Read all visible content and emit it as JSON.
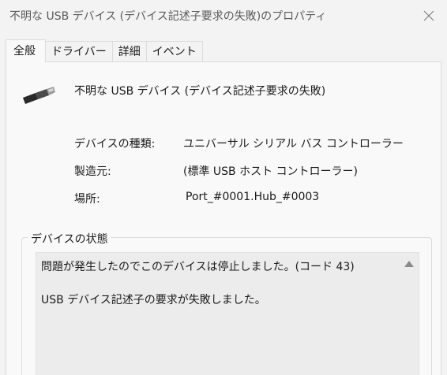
{
  "window": {
    "title": "不明な USB デバイス (デバイス記述子要求の失敗)のプロパティ"
  },
  "tabs": [
    {
      "label": "全般"
    },
    {
      "label": "ドライバー"
    },
    {
      "label": "詳細"
    },
    {
      "label": "イベント"
    }
  ],
  "device": {
    "name": "不明な USB デバイス (デバイス記述子要求の失敗)",
    "icon": "usb-connector-icon"
  },
  "properties": {
    "type_label": "デバイスの種類:",
    "type_value": "ユニバーサル シリアル バス コントローラー",
    "manufacturer_label": "製造元:",
    "manufacturer_value": "(標準 USB ホスト コントローラー)",
    "location_label": "場所:",
    "location_value": "Port_#0001.Hub_#0003"
  },
  "status": {
    "group_title": "デバイスの状態",
    "line1": "問題が発生したのでこのデバイスは停止しました。(コード 43)",
    "line2": "USB デバイス記述子の要求が失敗しました。"
  },
  "colors": {
    "window_bg": "#f3f3f3",
    "panel_bg": "#f9f9f9",
    "status_bg": "#ececec"
  }
}
